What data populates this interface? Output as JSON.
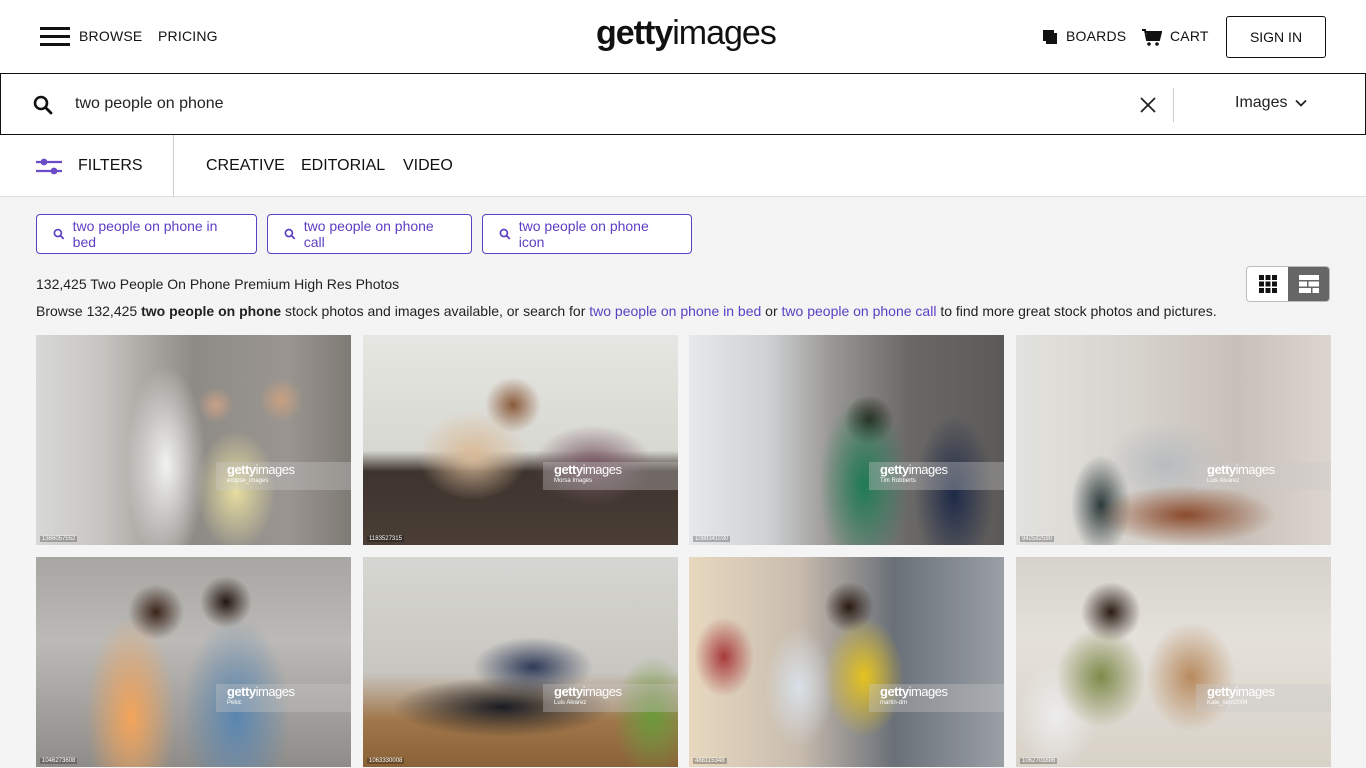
{
  "header": {
    "nav": [
      {
        "label": "BROWSE",
        "icon": "hamburger-menu-icon"
      },
      {
        "label": "PRICING"
      }
    ],
    "logo": {
      "bold": "getty",
      "light": "images"
    },
    "boards_label": "BOARDS",
    "cart_label": "CART",
    "signin_label": "SIGN IN"
  },
  "search": {
    "value": "two people on phone",
    "placeholder": "",
    "type_selected": "Images"
  },
  "filterbar": {
    "filters_label": "FILTERS",
    "tabs": [
      "CREATIVE",
      "EDITORIAL",
      "VIDEO"
    ]
  },
  "suggestions": [
    "two people on phone in bed",
    "two people on phone call",
    "two people on phone icon"
  ],
  "results": {
    "title": "132,425 Two People On Phone Premium High Res Photos",
    "desc_prefix": "Browse 132,425 ",
    "desc_bold": "two people on phone",
    "desc_mid": " stock photos and images available, or search for ",
    "desc_link1": "two people on phone in bed",
    "desc_or": " or ",
    "desc_link2": "two people on phone call",
    "desc_suffix": " to find more great stock photos and pictures."
  },
  "view_toggle": {
    "active": "mosaic",
    "options": [
      "grid",
      "mosaic"
    ]
  },
  "colors": {
    "accent": "#5b3fc4",
    "text": "#111111",
    "page_bg": "#f4f4f4"
  },
  "photos": [
    {
      "credit": "eclipse_images",
      "asset_id": "1366057552",
      "desc": "Two coworkers smiling looking at tablet in office"
    },
    {
      "credit": "Morsa Images",
      "asset_id": "1183527315",
      "desc": "Couple at table looking at phone with coffee"
    },
    {
      "credit": "Tim Robberts",
      "asset_id": "1088341030",
      "desc": "Two women looking at phones by window"
    },
    {
      "credit": "Luis Alvarez",
      "asset_id": "942582590",
      "desc": "Couple relaxing on leather sofa with phones"
    },
    {
      "credit": "Pekic",
      "asset_id": "1046273608",
      "desc": "Couple looking at phone outdoors"
    },
    {
      "credit": "Luis Alvarez",
      "asset_id": "1063330008",
      "desc": "Two women on black sofa with phones"
    },
    {
      "credit": "martin-dm",
      "asset_id": "488115348",
      "desc": "Two women walking on street looking at phone"
    },
    {
      "credit": "Kate_sept2004",
      "asset_id": "1062703886",
      "desc": "Two women lying on floor with tablet and phone"
    }
  ],
  "watermark": {
    "bold": "getty",
    "light": "images"
  }
}
